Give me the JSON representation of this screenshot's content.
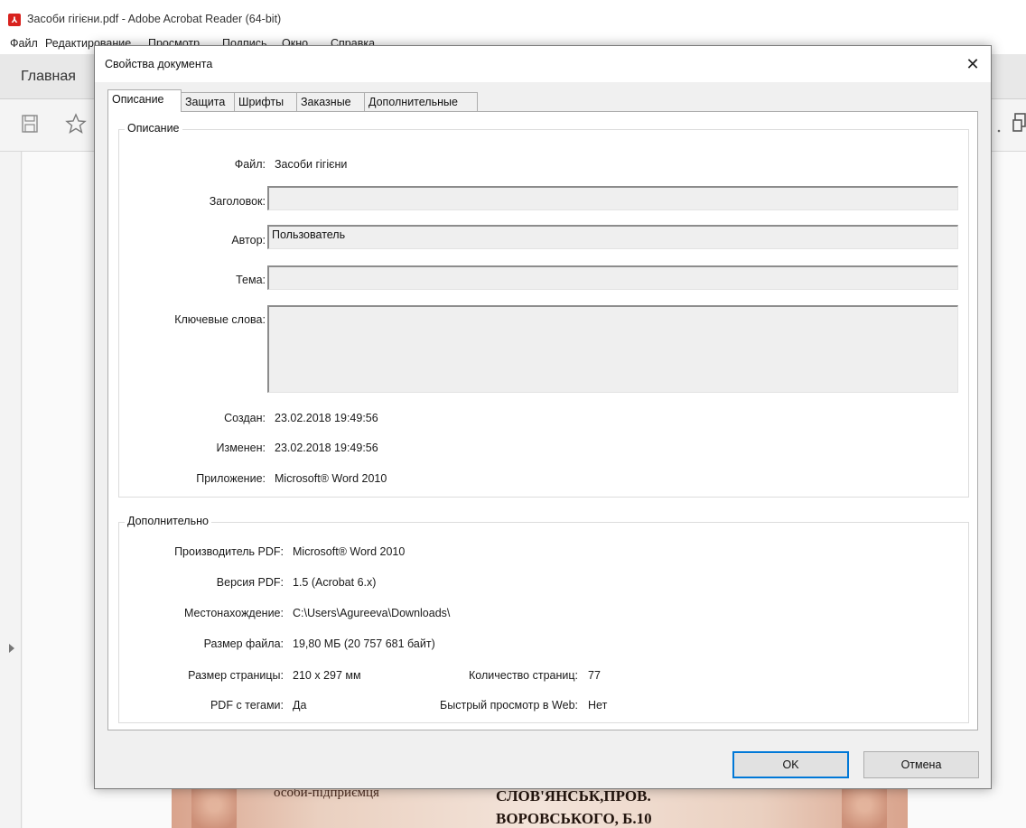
{
  "app": {
    "title": "Засоби гігієни.pdf - Adobe Acrobat Reader (64-bit)",
    "menu": [
      "Файл",
      "Редактирование",
      "Просмотр",
      "Подпись",
      "Окно",
      "Справка"
    ],
    "home_tab": "Главная"
  },
  "page_preview": {
    "text_left": "особи-підприємця",
    "text_right_line1": "СЛОВ'ЯНСЬК,ПРОВ.",
    "text_right_line2": "ВОРОВСЬКОГО, Б.10"
  },
  "dialog": {
    "title": "Свойства документа",
    "tabs": [
      "Описание",
      "Защита",
      "Шрифты",
      "Заказные",
      "Дополнительные"
    ],
    "active_tab": "Описание",
    "description": {
      "group_title": "Описание",
      "file_label": "Файл:",
      "file_value": "Засоби гігієни",
      "title_label": "Заголовок:",
      "title_value": "",
      "author_label": "Автор:",
      "author_value": "Пользователь",
      "subject_label": "Тема:",
      "subject_value": "",
      "keywords_label": "Ключевые слова:",
      "keywords_value": "",
      "created_label": "Создан:",
      "created_value": "23.02.2018 19:49:56",
      "modified_label": "Изменен:",
      "modified_value": "23.02.2018 19:49:56",
      "application_label": "Приложение:",
      "application_value": "Microsoft® Word 2010"
    },
    "advanced": {
      "group_title": "Дополнительно",
      "producer_label": "Производитель PDF:",
      "producer_value": "Microsoft® Word 2010",
      "version_label": "Версия PDF:",
      "version_value": "1.5 (Acrobat 6.x)",
      "location_label": "Местонахождение:",
      "location_value": "C:\\Users\\Agureeva\\Downloads\\",
      "filesize_label": "Размер файла:",
      "filesize_value": "19,80 МБ (20 757 681 байт)",
      "pagesize_label": "Размер страницы:",
      "pagesize_value": "210 x 297 мм",
      "pagecount_label": "Количество страниц:",
      "pagecount_value": "77",
      "tagged_label": "PDF с тегами:",
      "tagged_value": "Да",
      "fastweb_label": "Быстрый просмотр в Web:",
      "fastweb_value": "Нет"
    },
    "ok_label": "OK",
    "cancel_label": "Отмена"
  }
}
